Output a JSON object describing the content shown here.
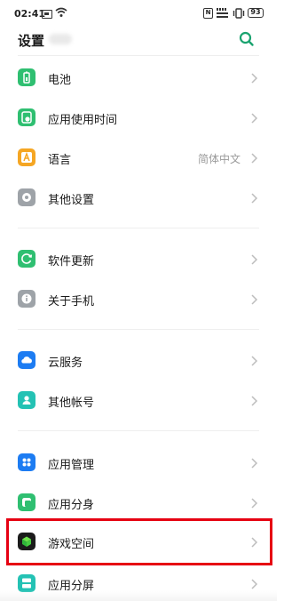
{
  "status_bar": {
    "time": "02:41",
    "nfc": "N",
    "lte": "LOGO\n⌁ 4G",
    "battery": "93"
  },
  "header": {
    "title": "设置",
    "search_icon": "search-icon",
    "accent": "#1aa36f"
  },
  "items": [
    {
      "label": "电池",
      "icon": "battery-icon",
      "color": "#2fbf71",
      "value": ""
    },
    {
      "label": "应用使用时间",
      "icon": "app-usage-time-icon",
      "color": "#2fbf71",
      "value": ""
    },
    {
      "label": "语言",
      "icon": "language-icon",
      "color": "#f5a623",
      "value": "简体中文"
    },
    {
      "label": "其他设置",
      "icon": "other-settings-icon",
      "color": "#9ea3a8",
      "value": ""
    },
    {
      "label": "软件更新",
      "icon": "software-update-icon",
      "color": "#2fbf71",
      "value": ""
    },
    {
      "label": "关于手机",
      "icon": "about-phone-icon",
      "color": "#9ea3a8",
      "value": ""
    },
    {
      "label": "云服务",
      "icon": "cloud-service-icon",
      "color": "#1d7cf2",
      "value": ""
    },
    {
      "label": "其他帐号",
      "icon": "other-accounts-icon",
      "color": "#24c2b4",
      "value": ""
    },
    {
      "label": "应用管理",
      "icon": "app-management-icon",
      "color": "#1d7cf2",
      "value": ""
    },
    {
      "label": "应用分身",
      "icon": "app-clone-icon",
      "color": "#2fbf71",
      "value": ""
    },
    {
      "label": "游戏空间",
      "icon": "game-space-icon",
      "color": "#1b1b1b",
      "value": ""
    },
    {
      "label": "应用分屏",
      "icon": "split-screen-icon",
      "color": "#24c2b4",
      "value": ""
    }
  ],
  "highlight_color": "#e60012"
}
